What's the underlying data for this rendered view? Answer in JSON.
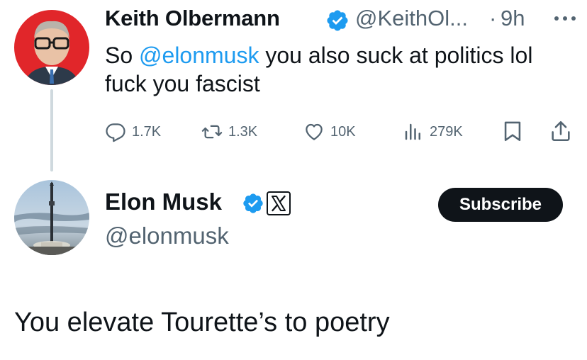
{
  "parent_tweet": {
    "author_name": "Keith Olbermann",
    "handle": "@KeithOl...",
    "separator": "·",
    "time": "9h",
    "text_prefix": "So ",
    "mention": "@elonmusk",
    "text_suffix": " you also suck at politics lol fuck you fascist",
    "stats": {
      "replies": "1.7K",
      "reposts": "1.3K",
      "likes": "10K",
      "views": "279K"
    },
    "icons": [
      "avatar-photo",
      "verified-badge-icon",
      "more-options-icon",
      "reply-icon",
      "repost-icon",
      "like-icon",
      "views-icon",
      "bookmark-icon",
      "share-icon"
    ]
  },
  "reply_tweet": {
    "author_name": "Elon Musk",
    "handle": "@elonmusk",
    "subscribe_label": "Subscribe",
    "text": "You elevate Tourette’s to poetry",
    "icons": [
      "avatar-rocket-photo",
      "verified-badge-icon",
      "x-affiliate-badge-icon"
    ]
  },
  "colors": {
    "text": "#0f1419",
    "secondary": "#536471",
    "accent": "#1d9bf0",
    "thread_line": "#cfd9de",
    "button_bg": "#0f1419"
  }
}
